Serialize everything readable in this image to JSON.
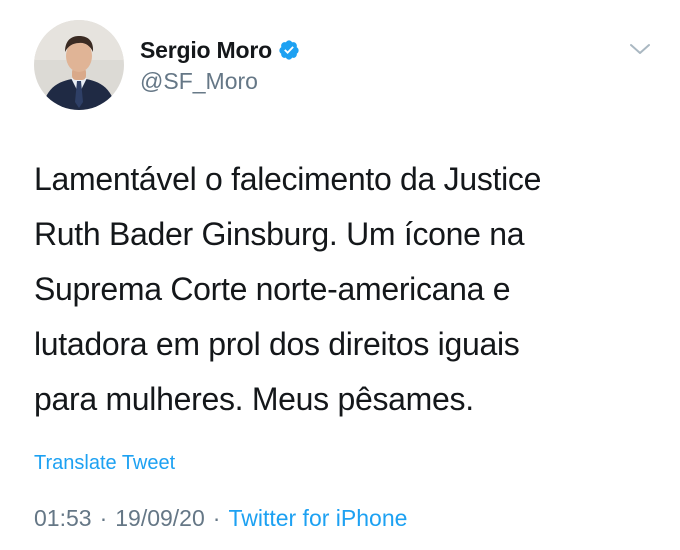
{
  "author": {
    "display_name": "Sergio Moro",
    "handle": "@SF_Moro",
    "verified": true
  },
  "tweet": {
    "lines": [
      "Lamentável o falecimento da Justice",
      "Ruth Bader Ginsburg. Um ícone na",
      "Suprema Corte norte-americana e",
      "lutadora em prol dos direitos iguais",
      "para mulheres. Meus pêsames."
    ]
  },
  "actions": {
    "translate_label": "Translate Tweet"
  },
  "meta": {
    "time": "01:53",
    "date": "19/09/20",
    "separator": "·",
    "source": "Twitter for iPhone"
  },
  "colors": {
    "link": "#1da1f2",
    "secondary_text": "#657786",
    "primary_text": "#14171a",
    "caret": "#aab8c2"
  },
  "icons": {
    "verified": "verified-badge-icon",
    "caret": "chevron-down-icon"
  }
}
